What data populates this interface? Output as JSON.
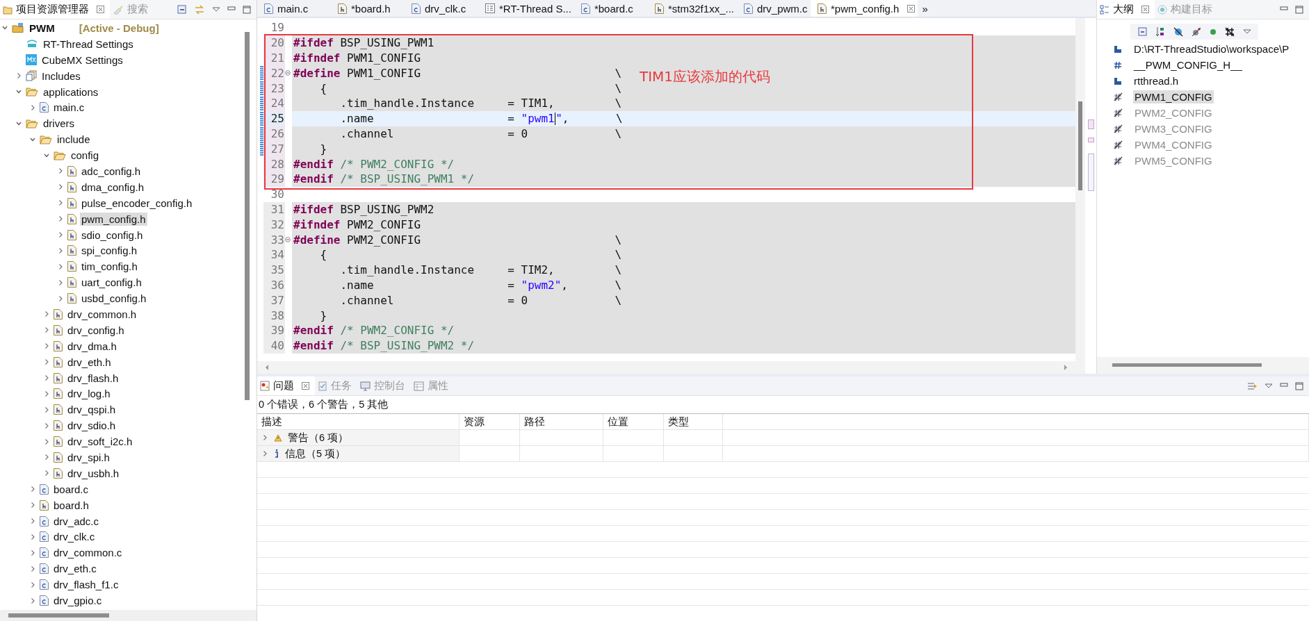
{
  "explorer": {
    "tabs": [
      {
        "label": "项目资源管理器",
        "selected": true,
        "closable": true
      },
      {
        "label": "搜索",
        "selected": false,
        "closable": false
      }
    ],
    "tree": [
      {
        "kind": "project",
        "label": "PWM",
        "decoration": "[Active - Debug]",
        "expanded": true,
        "selected": false,
        "children": [
          {
            "kind": "rt",
            "label": "RT-Thread Settings",
            "selected": false
          },
          {
            "kind": "mx",
            "label": "CubeMX Settings",
            "selected": false
          },
          {
            "kind": "includes",
            "label": "Includes",
            "expanded": false,
            "selected": false
          },
          {
            "kind": "folder",
            "label": "applications",
            "expanded": true,
            "selected": false,
            "children": [
              {
                "kind": "c",
                "label": "main.c",
                "expanded": false,
                "selected": false
              }
            ]
          },
          {
            "kind": "folder",
            "label": "drivers",
            "expanded": true,
            "selected": false,
            "children": [
              {
                "kind": "folder",
                "label": "include",
                "expanded": true,
                "selected": false,
                "children": [
                  {
                    "kind": "folder",
                    "label": "config",
                    "expanded": true,
                    "selected": false,
                    "children": [
                      {
                        "kind": "h",
                        "label": "adc_config.h",
                        "expanded": false,
                        "selected": false
                      },
                      {
                        "kind": "h",
                        "label": "dma_config.h",
                        "expanded": false,
                        "selected": false
                      },
                      {
                        "kind": "h",
                        "label": "pulse_encoder_config.h",
                        "expanded": false,
                        "selected": false
                      },
                      {
                        "kind": "h",
                        "label": "pwm_config.h",
                        "expanded": false,
                        "selected": true
                      },
                      {
                        "kind": "h",
                        "label": "sdio_config.h",
                        "expanded": false,
                        "selected": false
                      },
                      {
                        "kind": "h",
                        "label": "spi_config.h",
                        "expanded": false,
                        "selected": false
                      },
                      {
                        "kind": "h",
                        "label": "tim_config.h",
                        "expanded": false,
                        "selected": false
                      },
                      {
                        "kind": "h",
                        "label": "uart_config.h",
                        "expanded": false,
                        "selected": false
                      },
                      {
                        "kind": "h",
                        "label": "usbd_config.h",
                        "expanded": false,
                        "selected": false
                      }
                    ]
                  },
                  {
                    "kind": "h",
                    "label": "drv_common.h",
                    "expanded": false,
                    "selected": false
                  },
                  {
                    "kind": "h",
                    "label": "drv_config.h",
                    "expanded": false,
                    "selected": false
                  },
                  {
                    "kind": "h",
                    "label": "drv_dma.h",
                    "expanded": false,
                    "selected": false
                  },
                  {
                    "kind": "h",
                    "label": "drv_eth.h",
                    "expanded": false,
                    "selected": false
                  },
                  {
                    "kind": "h",
                    "label": "drv_flash.h",
                    "expanded": false,
                    "selected": false
                  },
                  {
                    "kind": "h",
                    "label": "drv_log.h",
                    "expanded": false,
                    "selected": false
                  },
                  {
                    "kind": "h",
                    "label": "drv_qspi.h",
                    "expanded": false,
                    "selected": false
                  },
                  {
                    "kind": "h",
                    "label": "drv_sdio.h",
                    "expanded": false,
                    "selected": false
                  },
                  {
                    "kind": "h",
                    "label": "drv_soft_i2c.h",
                    "expanded": false,
                    "selected": false
                  },
                  {
                    "kind": "h",
                    "label": "drv_spi.h",
                    "expanded": false,
                    "selected": false
                  },
                  {
                    "kind": "h",
                    "label": "drv_usbh.h",
                    "expanded": false,
                    "selected": false
                  }
                ]
              },
              {
                "kind": "c",
                "label": "board.c",
                "expanded": false,
                "selected": false
              },
              {
                "kind": "h",
                "label": "board.h",
                "expanded": false,
                "selected": false
              },
              {
                "kind": "c",
                "label": "drv_adc.c",
                "expanded": false,
                "selected": false
              },
              {
                "kind": "c",
                "label": "drv_clk.c",
                "expanded": false,
                "selected": false
              },
              {
                "kind": "c",
                "label": "drv_common.c",
                "expanded": false,
                "selected": false
              },
              {
                "kind": "c",
                "label": "drv_eth.c",
                "expanded": false,
                "selected": false
              },
              {
                "kind": "c",
                "label": "drv_flash_f1.c",
                "expanded": false,
                "selected": false
              },
              {
                "kind": "c",
                "label": "drv_gpio.c",
                "expanded": false,
                "selected": false
              }
            ]
          }
        ]
      }
    ]
  },
  "editor": {
    "tabs": [
      {
        "kind": "c",
        "label": "main.c",
        "selected": false
      },
      {
        "kind": "h",
        "label": "*board.h",
        "selected": false
      },
      {
        "kind": "c",
        "label": "drv_clk.c",
        "selected": false
      },
      {
        "kind": "settings",
        "label": "*RT-Thread S...",
        "selected": false
      },
      {
        "kind": "c",
        "label": "*board.c",
        "selected": false
      },
      {
        "kind": "h",
        "label": "*stm32f1xx_...",
        "selected": false
      },
      {
        "kind": "c",
        "label": "drv_pwm.c",
        "selected": false
      },
      {
        "kind": "h",
        "label": "*pwm_config.h",
        "selected": true
      }
    ],
    "overflow": "»",
    "groups": [
      {
        "boxed": false,
        "lines": [
          {
            "n": "19",
            "shaded": false,
            "current": false,
            "changed": false,
            "fold": false
          }
        ]
      },
      {
        "boxed": true,
        "note": "TIM1应该添加的代码",
        "lines": [
          {
            "n": "20",
            "shaded": true,
            "current": false,
            "changed": false,
            "fold": false,
            "parts": [
              {
                "kind": "kw",
                "text": "#ifdef"
              },
              {
                "kind": "plain",
                "text": " BSP_USING_PWM1"
              }
            ]
          },
          {
            "n": "21",
            "shaded": true,
            "current": false,
            "changed": false,
            "fold": false,
            "parts": [
              {
                "kind": "kw",
                "text": "#ifndef"
              },
              {
                "kind": "plain",
                "text": " PWM1_CONFIG"
              }
            ]
          },
          {
            "n": "22",
            "shaded": true,
            "current": false,
            "changed": true,
            "fold": true,
            "parts": [
              {
                "kind": "kw",
                "text": "#define"
              },
              {
                "kind": "plain",
                "text": " PWM1_CONFIG                             \\"
              }
            ]
          },
          {
            "n": "23",
            "shaded": true,
            "current": false,
            "changed": true,
            "fold": false,
            "parts": [
              {
                "kind": "plain",
                "text": "    {                                           \\"
              }
            ]
          },
          {
            "n": "24",
            "shaded": true,
            "current": false,
            "changed": true,
            "fold": false,
            "parts": [
              {
                "kind": "plain",
                "text": "       .tim_handle.Instance     = TIM1,         \\"
              }
            ]
          },
          {
            "n": "25",
            "shaded": true,
            "current": true,
            "changed": true,
            "fold": false,
            "parts": [
              {
                "kind": "plain",
                "text": "       .name                    = "
              },
              {
                "kind": "string",
                "text": "\"pwm1"
              },
              {
                "kind": "cursor"
              },
              {
                "kind": "string",
                "text": "\""
              },
              {
                "kind": "plain",
                "text": ",       \\"
              }
            ]
          },
          {
            "n": "26",
            "shaded": true,
            "current": false,
            "changed": true,
            "fold": false,
            "parts": [
              {
                "kind": "plain",
                "text": "       .channel                 = 0             \\"
              }
            ]
          },
          {
            "n": "27",
            "shaded": true,
            "current": false,
            "changed": true,
            "fold": false,
            "parts": [
              {
                "kind": "plain",
                "text": "    }"
              }
            ]
          },
          {
            "n": "28",
            "shaded": true,
            "current": false,
            "changed": false,
            "fold": false,
            "parts": [
              {
                "kind": "kw",
                "text": "#endif"
              },
              {
                "kind": "comment",
                "text": " /* PWM2_CONFIG */"
              }
            ]
          },
          {
            "n": "29",
            "shaded": true,
            "current": false,
            "changed": false,
            "fold": false,
            "parts": [
              {
                "kind": "kw",
                "text": "#endif"
              },
              {
                "kind": "comment",
                "text": " /* BSP_USING_PWM1 */"
              }
            ]
          }
        ]
      },
      {
        "boxed": false,
        "lines": [
          {
            "n": "30",
            "shaded": false,
            "current": false,
            "changed": false,
            "fold": false
          },
          {
            "n": "31",
            "shaded": true,
            "current": false,
            "changed": false,
            "fold": false,
            "parts": [
              {
                "kind": "kw",
                "text": "#ifdef"
              },
              {
                "kind": "plain",
                "text": " BSP_USING_PWM2"
              }
            ]
          },
          {
            "n": "32",
            "shaded": true,
            "current": false,
            "changed": false,
            "fold": false,
            "parts": [
              {
                "kind": "kw",
                "text": "#ifndef"
              },
              {
                "kind": "plain",
                "text": " PWM2_CONFIG"
              }
            ]
          },
          {
            "n": "33",
            "shaded": true,
            "current": false,
            "changed": false,
            "fold": true,
            "parts": [
              {
                "kind": "kw",
                "text": "#define"
              },
              {
                "kind": "plain",
                "text": " PWM2_CONFIG                             \\"
              }
            ]
          },
          {
            "n": "34",
            "shaded": true,
            "current": false,
            "changed": false,
            "fold": false,
            "parts": [
              {
                "kind": "plain",
                "text": "    {                                           \\"
              }
            ]
          },
          {
            "n": "35",
            "shaded": true,
            "current": false,
            "changed": false,
            "fold": false,
            "parts": [
              {
                "kind": "plain",
                "text": "       .tim_handle.Instance     = TIM2,         \\"
              }
            ]
          },
          {
            "n": "36",
            "shaded": true,
            "current": false,
            "changed": false,
            "fold": false,
            "parts": [
              {
                "kind": "plain",
                "text": "       .name                    = "
              },
              {
                "kind": "string",
                "text": "\"pwm2\""
              },
              {
                "kind": "plain",
                "text": ",       \\"
              }
            ]
          },
          {
            "n": "37",
            "shaded": true,
            "current": false,
            "changed": false,
            "fold": false,
            "parts": [
              {
                "kind": "plain",
                "text": "       .channel                 = 0             \\"
              }
            ]
          },
          {
            "n": "38",
            "shaded": true,
            "current": false,
            "changed": false,
            "fold": false,
            "parts": [
              {
                "kind": "plain",
                "text": "    }"
              }
            ]
          },
          {
            "n": "39",
            "shaded": true,
            "current": false,
            "changed": false,
            "fold": false,
            "parts": [
              {
                "kind": "kw",
                "text": "#endif"
              },
              {
                "kind": "comment",
                "text": " /* PWM2_CONFIG */"
              }
            ]
          },
          {
            "n": "40",
            "shaded": true,
            "current": false,
            "changed": false,
            "fold": false,
            "parts": [
              {
                "kind": "kw",
                "text": "#endif"
              },
              {
                "kind": "comment",
                "text": " /* BSP_USING_PWM2 */"
              }
            ]
          }
        ]
      }
    ]
  },
  "outline": {
    "tabs": [
      {
        "label": "大纲",
        "selected": true,
        "closable": true
      },
      {
        "label": "构建目标",
        "selected": false,
        "closable": false
      }
    ],
    "items": [
      {
        "kind": "include",
        "label": "D:\\RT-ThreadStudio\\workspace\\P",
        "selected": false,
        "disabled": false
      },
      {
        "kind": "macro",
        "label": "__PWM_CONFIG_H__",
        "selected": false,
        "disabled": false
      },
      {
        "kind": "include",
        "label": "rtthread.h",
        "selected": false,
        "disabled": false
      },
      {
        "kind": "define",
        "label": "PWM1_CONFIG",
        "selected": true,
        "disabled": false
      },
      {
        "kind": "define",
        "label": "PWM2_CONFIG",
        "selected": false,
        "disabled": true
      },
      {
        "kind": "define",
        "label": "PWM3_CONFIG",
        "selected": false,
        "disabled": true
      },
      {
        "kind": "define",
        "label": "PWM4_CONFIG",
        "selected": false,
        "disabled": true
      },
      {
        "kind": "define",
        "label": "PWM5_CONFIG",
        "selected": false,
        "disabled": true
      }
    ]
  },
  "problems": {
    "tabs": [
      {
        "kind": "problems",
        "label": "问题",
        "selected": true,
        "closable": true
      },
      {
        "kind": "tasks",
        "label": "任务",
        "selected": false,
        "closable": false
      },
      {
        "kind": "console",
        "label": "控制台",
        "selected": false,
        "closable": false
      },
      {
        "kind": "properties",
        "label": "属性",
        "selected": false,
        "closable": false
      }
    ],
    "summary": "0 个错误，6 个警告，5 其他",
    "columns": [
      "描述",
      "资源",
      "路径",
      "位置",
      "类型"
    ],
    "rows": [
      {
        "kind": "warning",
        "label": "警告（6 项）",
        "expanded": false
      },
      {
        "kind": "info",
        "label": "信息（5 项）",
        "expanded": false
      }
    ]
  }
}
